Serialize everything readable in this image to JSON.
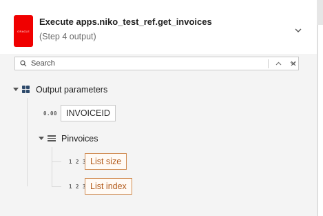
{
  "header": {
    "logo_text": "ORACLE",
    "title": "Execute apps.niko_test_ref.get_invoices",
    "subtitle": "(Step 4 output)"
  },
  "search": {
    "placeholder": "Search"
  },
  "tree": {
    "root": {
      "label": "Output parameters"
    },
    "children": [
      {
        "type_tag": "0.00",
        "label": "INVOICEID"
      },
      {
        "label": "Pinvoices",
        "children": [
          {
            "type_tag": "1 2 3",
            "label": "List size"
          },
          {
            "type_tag": "1 2 3",
            "label": "List index"
          }
        ]
      }
    ]
  },
  "colors": {
    "logo": "#f00000",
    "accent_orange": "#b25a1a",
    "grid_icon": "#2e4a6b"
  }
}
